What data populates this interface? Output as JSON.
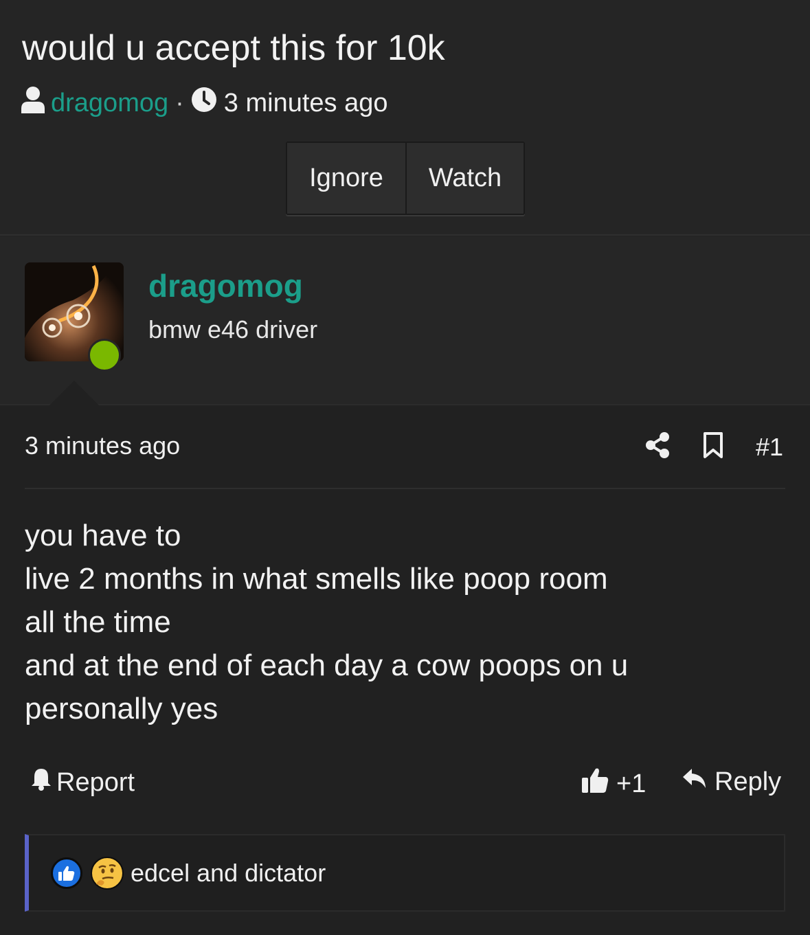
{
  "thread": {
    "title": "would u accept this for 10k",
    "author": "dragomog",
    "separator": "·",
    "time": "3 minutes ago",
    "buttons": {
      "ignore": "Ignore",
      "watch": "Watch"
    }
  },
  "post": {
    "author": "dragomog",
    "user_title": "bmw e46 driver",
    "online": true,
    "time": "3 minutes ago",
    "number": "#1",
    "lines": [
      "you have to",
      "live 2 months in what smells like poop room",
      "all the time",
      "and at the end of each day a cow poops on u",
      "personally yes"
    ],
    "actions": {
      "report": "Report",
      "like_count": "+1",
      "reply": "Reply"
    },
    "reactions": {
      "icons": [
        "like-reaction-icon",
        "thinking-reaction-icon"
      ],
      "users": "edcel and dictator"
    }
  },
  "colors": {
    "accent": "#1b9e8a",
    "online": "#7ab800",
    "reaction_bar": "#5a63c8",
    "background": "#242424"
  }
}
